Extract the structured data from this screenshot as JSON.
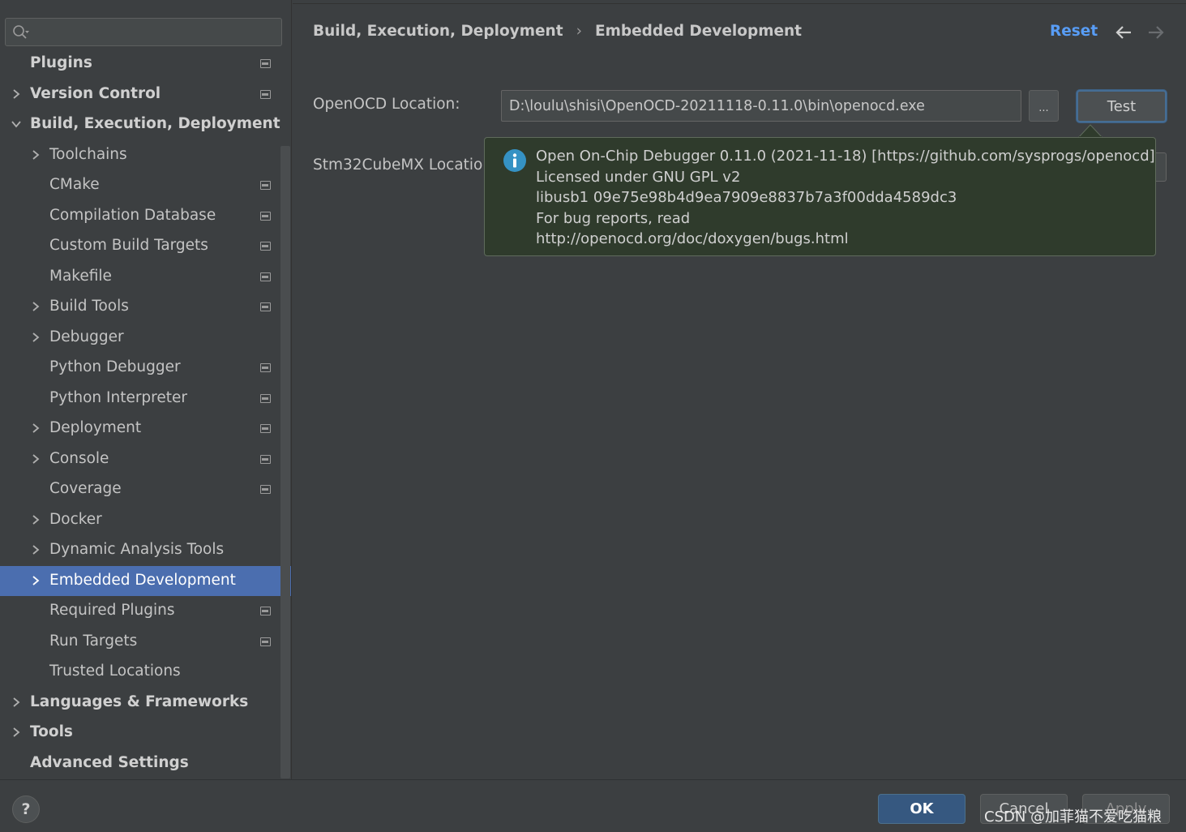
{
  "search": {
    "placeholder": "",
    "value": ""
  },
  "sidebar": {
    "items": [
      {
        "label": "Plugins",
        "level": 0,
        "bold": true,
        "expandable": false,
        "expanded": false,
        "project_icon": true,
        "selected": false
      },
      {
        "label": "Version Control",
        "level": 0,
        "bold": true,
        "expandable": true,
        "expanded": false,
        "project_icon": true,
        "selected": false
      },
      {
        "label": "Build, Execution, Deployment",
        "level": 0,
        "bold": true,
        "expandable": true,
        "expanded": true,
        "project_icon": false,
        "selected": false
      },
      {
        "label": "Toolchains",
        "level": 1,
        "bold": false,
        "expandable": true,
        "expanded": false,
        "project_icon": false,
        "selected": false
      },
      {
        "label": "CMake",
        "level": 1,
        "bold": false,
        "expandable": false,
        "expanded": false,
        "project_icon": true,
        "selected": false
      },
      {
        "label": "Compilation Database",
        "level": 1,
        "bold": false,
        "expandable": false,
        "expanded": false,
        "project_icon": true,
        "selected": false
      },
      {
        "label": "Custom Build Targets",
        "level": 1,
        "bold": false,
        "expandable": false,
        "expanded": false,
        "project_icon": true,
        "selected": false
      },
      {
        "label": "Makefile",
        "level": 1,
        "bold": false,
        "expandable": false,
        "expanded": false,
        "project_icon": true,
        "selected": false
      },
      {
        "label": "Build Tools",
        "level": 1,
        "bold": false,
        "expandable": true,
        "expanded": false,
        "project_icon": true,
        "selected": false
      },
      {
        "label": "Debugger",
        "level": 1,
        "bold": false,
        "expandable": true,
        "expanded": false,
        "project_icon": false,
        "selected": false
      },
      {
        "label": "Python Debugger",
        "level": 1,
        "bold": false,
        "expandable": false,
        "expanded": false,
        "project_icon": true,
        "selected": false
      },
      {
        "label": "Python Interpreter",
        "level": 1,
        "bold": false,
        "expandable": false,
        "expanded": false,
        "project_icon": true,
        "selected": false
      },
      {
        "label": "Deployment",
        "level": 1,
        "bold": false,
        "expandable": true,
        "expanded": false,
        "project_icon": true,
        "selected": false
      },
      {
        "label": "Console",
        "level": 1,
        "bold": false,
        "expandable": true,
        "expanded": false,
        "project_icon": true,
        "selected": false
      },
      {
        "label": "Coverage",
        "level": 1,
        "bold": false,
        "expandable": false,
        "expanded": false,
        "project_icon": true,
        "selected": false
      },
      {
        "label": "Docker",
        "level": 1,
        "bold": false,
        "expandable": true,
        "expanded": false,
        "project_icon": false,
        "selected": false
      },
      {
        "label": "Dynamic Analysis Tools",
        "level": 1,
        "bold": false,
        "expandable": true,
        "expanded": false,
        "project_icon": false,
        "selected": false
      },
      {
        "label": "Embedded Development",
        "level": 1,
        "bold": false,
        "expandable": true,
        "expanded": false,
        "project_icon": false,
        "selected": true
      },
      {
        "label": "Required Plugins",
        "level": 1,
        "bold": false,
        "expandable": false,
        "expanded": false,
        "project_icon": true,
        "selected": false
      },
      {
        "label": "Run Targets",
        "level": 1,
        "bold": false,
        "expandable": false,
        "expanded": false,
        "project_icon": true,
        "selected": false
      },
      {
        "label": "Trusted Locations",
        "level": 1,
        "bold": false,
        "expandable": false,
        "expanded": false,
        "project_icon": false,
        "selected": false
      },
      {
        "label": "Languages & Frameworks",
        "level": 0,
        "bold": true,
        "expandable": true,
        "expanded": false,
        "project_icon": false,
        "selected": false
      },
      {
        "label": "Tools",
        "level": 0,
        "bold": true,
        "expandable": true,
        "expanded": false,
        "project_icon": false,
        "selected": false
      },
      {
        "label": "Advanced Settings",
        "level": 0,
        "bold": true,
        "expandable": false,
        "expanded": false,
        "project_icon": false,
        "selected": false
      }
    ]
  },
  "header": {
    "breadcrumb": [
      "Build, Execution, Deployment",
      "Embedded Development"
    ],
    "separator": "›",
    "reset_label": "Reset"
  },
  "form": {
    "openocd_label": "OpenOCD Location:",
    "openocd_value": "D:\\loulu\\shisi\\OpenOCD-20211118-0.11.0\\bin\\openocd.exe",
    "browse_label": "...",
    "test_label": "Test",
    "stm32_label": "Stm32CubeMX Location:"
  },
  "popup": {
    "lines": [
      "Open On-Chip Debugger 0.11.0 (2021-11-18) [https://github.com/sysprogs/openocd]",
      "Licensed under GNU GPL v2",
      "libusb1 09e75e98b4d9ea7909e8837b7a3f00dda4589dc3",
      "For bug reports, read",
      "http://openocd.org/doc/doxygen/bugs.html"
    ]
  },
  "footer": {
    "help_label": "?",
    "ok_label": "OK",
    "cancel_label": "Cancel",
    "apply_label": "Apply",
    "watermark": "CSDN @加菲猫不爱吃猫粮"
  },
  "colors": {
    "background": "#3c3f41",
    "selection": "#4b6eaf",
    "link": "#589df6",
    "popup_bg": "#2f3b2c",
    "info_icon": "#3592c4",
    "ok_button": "#365880"
  }
}
